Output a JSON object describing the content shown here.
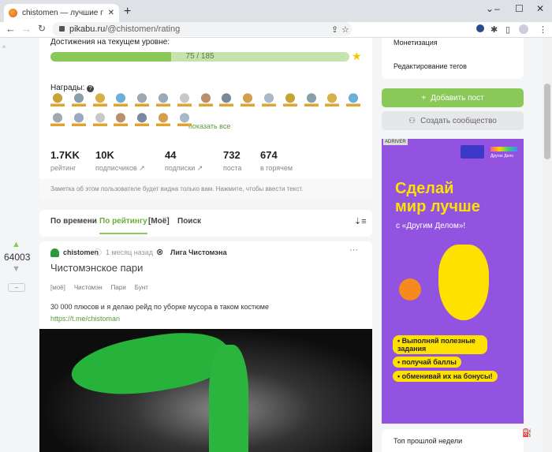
{
  "browser": {
    "tab_title": "chistomen — лучшие посты по р",
    "url_domain": "pikabu.ru",
    "url_path": "/@chistomen/rating"
  },
  "profile": {
    "achievements_label": "Достижения на текущем уровне:",
    "progress_text": "75 / 185",
    "progress_fraction": 0.405,
    "awards_label": "Награды:",
    "show_all": "показать все",
    "stats": [
      {
        "value": "1.7KK",
        "label": "рейтинг"
      },
      {
        "value": "10K",
        "label": "подписчиков"
      },
      {
        "value": "44",
        "label": "подписки"
      },
      {
        "value": "732",
        "label": "поста"
      },
      {
        "value": "674",
        "label": "в горячем"
      }
    ],
    "note": "Заметка об этом пользователе будет видна только вам. Нажмите, чтобы ввести текст."
  },
  "sort_tabs": [
    {
      "label": "По времени"
    },
    {
      "label": "По рейтингу",
      "active": true
    },
    {
      "label": "[Моё]"
    },
    {
      "label": "Поиск"
    }
  ],
  "post": {
    "rating": "64003",
    "author": "chistomen",
    "time": "1 месяц назад",
    "community": "Лига Чистомэна",
    "title": "Чистомэнское пари",
    "tags": [
      "[моё]",
      "Чистомэн",
      "Пари",
      "Бунт"
    ],
    "text": "30 000 плюсов и я делаю рейд по уборке мусора в таком костюме",
    "link": "https://t.me/chistoman",
    "collapse": "–"
  },
  "sidebar": {
    "menu": [
      "Монетизация",
      "Редактирование тегов"
    ],
    "add_post": "Добавить пост",
    "create_community": "Создать сообщество",
    "top_week": "Топ прошлой недели"
  },
  "ad": {
    "badge": "ADRIVER",
    "brand": "Другое Дело",
    "headline1": "Сделай",
    "headline2": "мир лучше",
    "sub": "с «Другим Делом»!",
    "bullets": [
      "Выполняй полезные задания",
      "получай баллы",
      "обменивай их на бонусы!"
    ]
  },
  "colors": {
    "accent": "#8ac858",
    "ad_bg": "#9153e0",
    "ad_yellow": "#ffe100"
  }
}
